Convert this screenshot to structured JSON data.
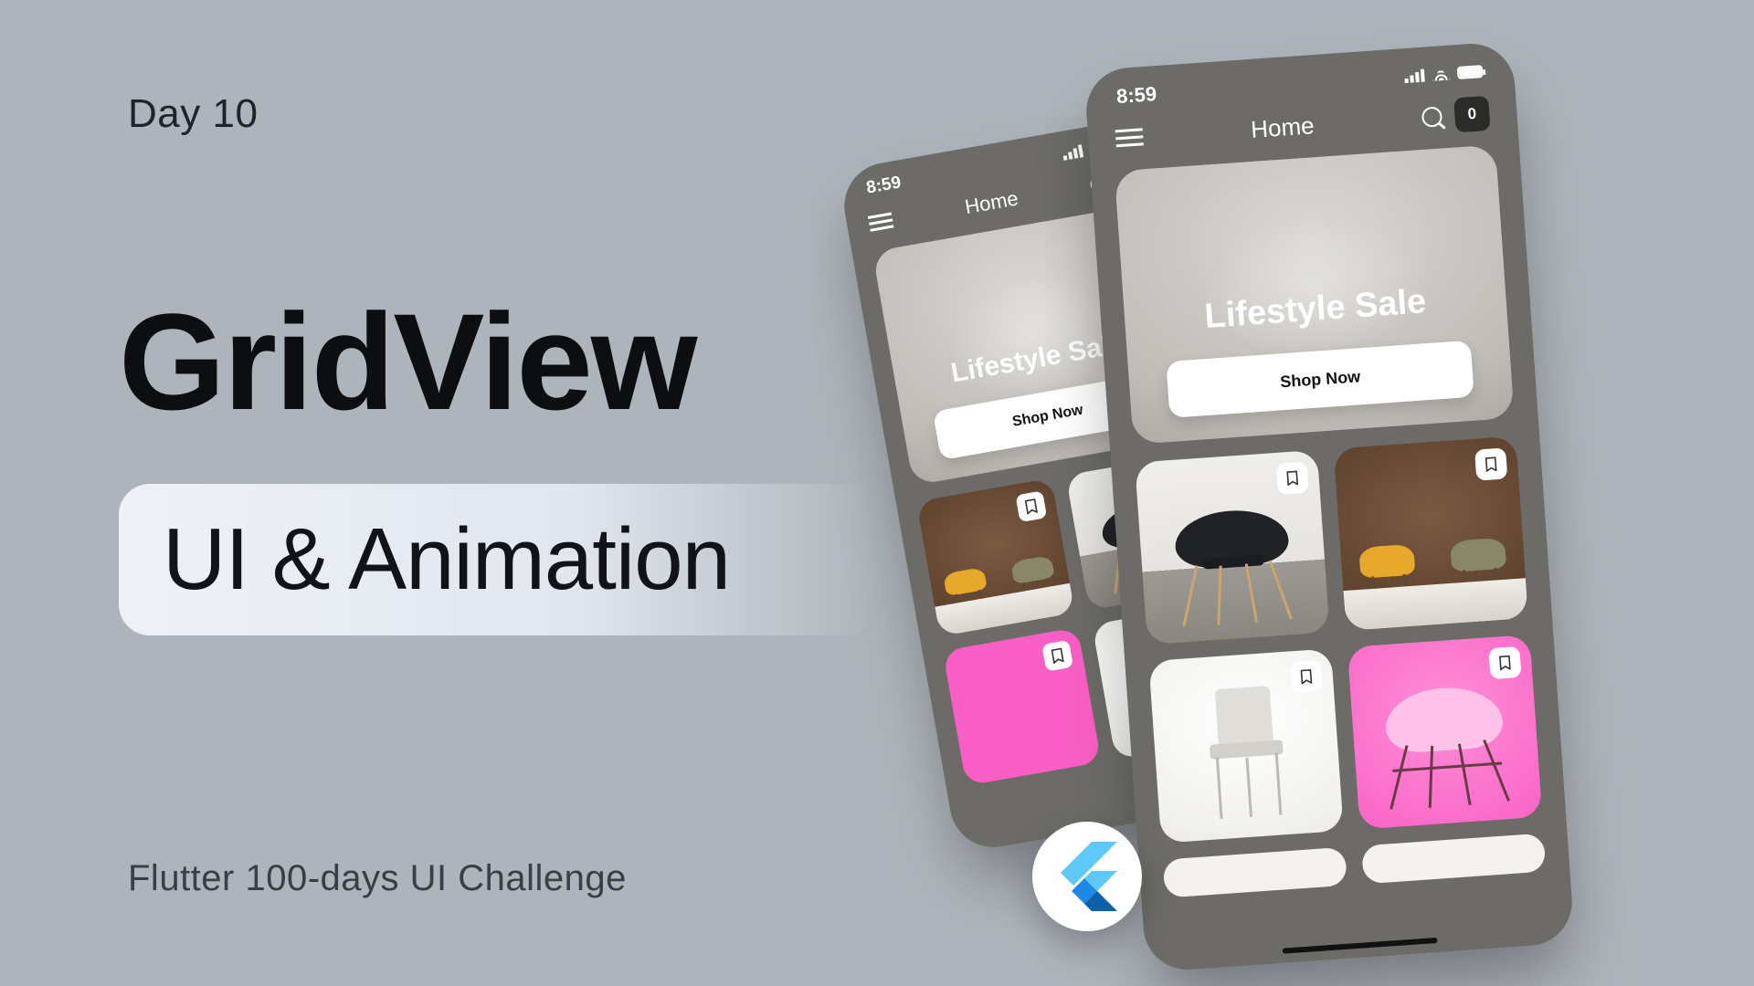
{
  "eyebrow": "Day 10",
  "title": "GridView",
  "pill": "UI & Animation",
  "footer": "Flutter 100-days UI Challenge",
  "phone": {
    "time": "8:59",
    "screen_title": "Home",
    "badge_count": "0",
    "hero_title": "Lifestyle Sale",
    "hero_cta": "Shop Now"
  },
  "badge": {
    "logo_name": "flutter"
  }
}
